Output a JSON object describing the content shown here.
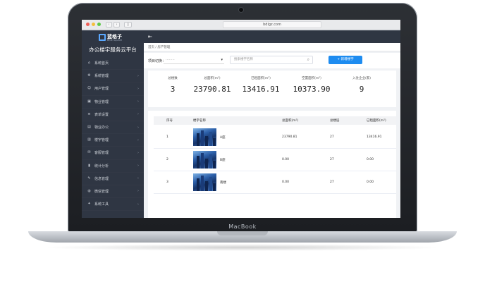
{
  "device": {
    "brand_label": "MacBook"
  },
  "browser": {
    "url": "bdlgz.com"
  },
  "app": {
    "logo_cn": "蓝格子",
    "logo_en": "Blue Square",
    "platform_title": "办公楼宇服务云平台"
  },
  "sidebar": {
    "items": [
      {
        "label": "系统首页",
        "icon": "home-icon",
        "glyph": "⌂",
        "has_arrow": false
      },
      {
        "label": "系统管理",
        "icon": "gear-icon",
        "glyph": "⚙",
        "has_arrow": true
      },
      {
        "label": "用户管理",
        "icon": "user-icon",
        "glyph": "☺",
        "has_arrow": true
      },
      {
        "label": "物业管理",
        "icon": "briefcase-icon",
        "glyph": "▣",
        "has_arrow": true
      },
      {
        "label": "表单设置",
        "icon": "form-icon",
        "glyph": "≡",
        "has_arrow": true
      },
      {
        "label": "物业办公",
        "icon": "office-icon",
        "glyph": "▤",
        "has_arrow": true
      },
      {
        "label": "楼宇管理",
        "icon": "building-icon",
        "glyph": "▥",
        "has_arrow": true
      },
      {
        "label": "客服管理",
        "icon": "service-icon",
        "glyph": "✉",
        "has_arrow": true
      },
      {
        "label": "统计分析",
        "icon": "chart-icon",
        "glyph": "▮",
        "has_arrow": true
      },
      {
        "label": "信息管理",
        "icon": "info-icon",
        "glyph": "✎",
        "has_arrow": true
      },
      {
        "label": "微信管理",
        "icon": "wechat-icon",
        "glyph": "◍",
        "has_arrow": true
      },
      {
        "label": "系统工具",
        "icon": "tools-icon",
        "glyph": "✦",
        "has_arrow": true
      }
    ]
  },
  "header": {
    "toggle_icon": "menu-toggle-icon"
  },
  "breadcrumb": {
    "text": "首页 / 房产管理"
  },
  "filter": {
    "project_label": "项目切换：",
    "project_value": "········",
    "search_placeholder": "搜索楼宇名称",
    "add_button": "+ 新增楼宇"
  },
  "stats": [
    {
      "label": "总楼数",
      "value": "3"
    },
    {
      "label": "总面积(m²)",
      "value": "23790.81"
    },
    {
      "label": "已租面积(m²)",
      "value": "13416.91"
    },
    {
      "label": "空置面积(m²)",
      "value": "10373.90"
    },
    {
      "label": "入驻企业(家)",
      "value": "9"
    }
  ],
  "table": {
    "columns": [
      "序号",
      "楼宇名称",
      "总面积(m²)",
      "总楼层",
      "已租面积(m²)"
    ],
    "rows": [
      {
        "index": "1",
        "name": "A座",
        "total_area": "23790.81",
        "floors": "27",
        "rented": "13416.91"
      },
      {
        "index": "2",
        "name": "B座",
        "total_area": "0.00",
        "floors": "27",
        "rented": "0.00"
      },
      {
        "index": "3",
        "name": "南楼",
        "total_area": "0.00",
        "floors": "27",
        "rented": "0.00"
      }
    ]
  },
  "colors": {
    "sidebar_bg": "#2f3643",
    "accent": "#1e8cf0"
  }
}
